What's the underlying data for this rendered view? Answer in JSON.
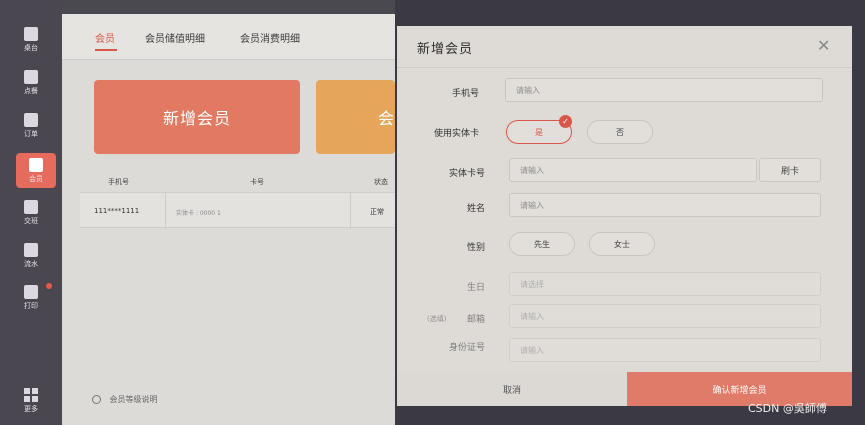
{
  "sidebar": {
    "items": [
      {
        "label": "桌台",
        "icon": "table-icon"
      },
      {
        "label": "点餐",
        "icon": "order-icon"
      },
      {
        "label": "订单",
        "icon": "receipt-icon"
      },
      {
        "label": "会员",
        "icon": "member-icon",
        "active": true
      },
      {
        "label": "交班",
        "icon": "handover-icon"
      },
      {
        "label": "流水",
        "icon": "ledger-icon"
      },
      {
        "label": "打印",
        "icon": "printer-icon"
      }
    ],
    "more_label": "更多"
  },
  "app": {
    "tabs": [
      {
        "label": "会员",
        "active": true
      },
      {
        "label": "会员储值明细"
      },
      {
        "label": "会员消费明细"
      }
    ],
    "cards": [
      {
        "label": "新增会员"
      },
      {
        "label": "会"
      }
    ],
    "table": {
      "headers": [
        "手机号",
        "卡号",
        "状态"
      ],
      "rows": [
        {
          "phone": "111****1111",
          "card_no": "实体卡 : 0000 1",
          "status": "正常"
        }
      ]
    },
    "footer_text": "会员等级说明"
  },
  "modal": {
    "title": "新增会员",
    "fields": {
      "phone": {
        "label": "手机号",
        "placeholder": "请输入"
      },
      "use_physical_card": {
        "label": "使用实体卡",
        "yes": "是",
        "no": "否"
      },
      "card_number": {
        "label": "实体卡号",
        "placeholder": "请输入",
        "swipe": "刷卡"
      },
      "name": {
        "label": "姓名",
        "placeholder": "请输入"
      },
      "gender": {
        "label": "性别",
        "male": "先生",
        "female": "女士"
      },
      "birthday": {
        "label": "生日",
        "placeholder": "请选择"
      },
      "email": {
        "label": "邮箱",
        "prefix": "(选填)",
        "placeholder": "请输入"
      },
      "id_number": {
        "label": "身份证号",
        "placeholder": "请输入"
      }
    },
    "cancel_label": "取消",
    "confirm_label": "确认新增会员"
  },
  "watermark": "CSDN @吳師傅",
  "colors": {
    "accent": "#d9574a",
    "card_primary": "#e27a63",
    "card_secondary": "#e5a55a"
  }
}
